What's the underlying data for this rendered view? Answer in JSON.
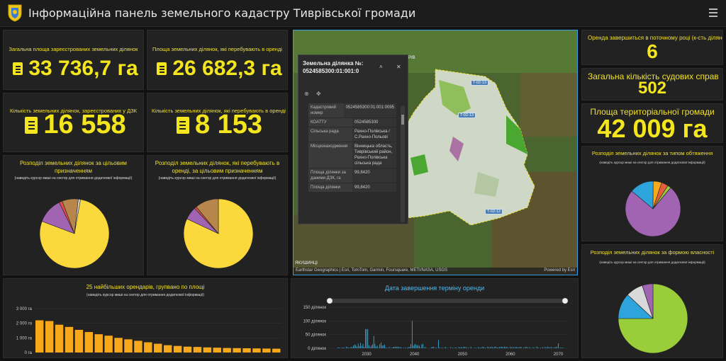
{
  "header": {
    "title": "Інформаційна панель земельного кадастру Тиврівської громади",
    "logo": "coat-of-arms",
    "menu_icon": "hamburger-menu"
  },
  "indicators": [
    {
      "title": "Загальна площа зареєстрованих земельних ділянок",
      "value": "33 736,7 га"
    },
    {
      "title": "Площа земельних ділянок, які перебувають в оренді",
      "value": "26 682,3 га"
    },
    {
      "title": "Кількість земельних ділянок, зареєстрованих у ДЗК",
      "value": "16 558"
    },
    {
      "title": "Кількість земельних ділянок, які перебувають в оренді",
      "value": "8 153"
    }
  ],
  "pie_purpose": {
    "title": "Розподіл земельних ділянок за цільовим призначенням",
    "hint": "(наведіть курсор миші на сектор для отримання додаткової інформації)"
  },
  "pie_lease": {
    "title": "Розподіл земельних ділянок, які перебувають в оренді, за цільовим призначенням",
    "hint": "(наведіть курсор миші на сектор для отримання додаткової інформації)"
  },
  "right_stats": [
    {
      "title": "Оренда завершиться в поточному році (к-сть ділянок)",
      "value": "6"
    },
    {
      "title": "Загальна кількість судових справ",
      "value": "502"
    },
    {
      "title": "Площа територіальної громади",
      "value": "42 009 га"
    }
  ],
  "pie_encumbrance": {
    "title": "Розподіл земельних ділянок за типом обтяження",
    "hint": "(наведіть курсор миші на сектор для отримання додаткової інформації)"
  },
  "pie_ownership": {
    "title": "Розподіл земельних ділянок за формою власності",
    "hint": "(наведіть курсор миші на сектор для отримання додаткової інформації)"
  },
  "map": {
    "attribution": "Earthstar Geographics | Esri, TomTom, Garmin, Foursquare, METI/NASA, USGS",
    "powered": "Powered by Esri",
    "road_labels": [
      "T-02-13",
      "T-02-13",
      "T-02-12"
    ],
    "place_labels": [
      "ТИВРІВ",
      "ЯКУШИНЦІ"
    ],
    "popup": {
      "title": "Земельна ділянка №: 0524585300:01:001:0",
      "collapse_icon": "chevron-up",
      "close_icon": "close",
      "tools": [
        "zoom-to-icon",
        "pan-icon"
      ],
      "rows": [
        {
          "key": "Кадастровий номер",
          "value": "0524585300:01:001:0095"
        },
        {
          "key": "КОАТТУ",
          "value": "0524585300"
        },
        {
          "key": "Сільська рада",
          "value": "Рахно-Полівська / С.Рахно-Польові"
        },
        {
          "key": "Місцезнаходження",
          "value": "Вінницька область, Тиврівський район, Рахно-Полівська сільська рада"
        },
        {
          "key": "Площа ділянки за даними ДЗК, га",
          "value": "99,8420"
        },
        {
          "key": "Площа ділянки",
          "value": "99,8420"
        }
      ]
    }
  },
  "bar_chart": {
    "title": "25 найбільших орендарів, групвано по площі",
    "hint": "(наведіть курсор миші на сектор для отримання додаткової інформації)"
  },
  "timeline": {
    "title": "Дата завершення терміну оренди"
  },
  "colors": {
    "accent": "#f3e51e",
    "bar": "#f7a81b",
    "timeline": "#3bb8e6"
  },
  "chart_data": [
    {
      "type": "pie",
      "name": "purpose",
      "values": [
        78,
        12,
        1.5,
        7.5,
        1
      ],
      "colors": [
        "#fbd93c",
        "#a064b3",
        "#e04b4b",
        "#b8864b",
        "#d9d9d9"
      ]
    },
    {
      "type": "pie",
      "name": "lease",
      "values": [
        82,
        6,
        1,
        11
      ],
      "colors": [
        "#fbd93c",
        "#a064b3",
        "#e04b4b",
        "#b8864b"
      ]
    },
    {
      "type": "pie",
      "name": "encumbrance",
      "values": [
        75,
        14,
        5,
        4,
        2
      ],
      "colors": [
        "#a064b3",
        "#2ea4dc",
        "#f7a81b",
        "#e45f3b",
        "#9acd3a"
      ]
    },
    {
      "type": "pie",
      "name": "ownership",
      "values": [
        75,
        12,
        8,
        5
      ],
      "colors": [
        "#9acd3a",
        "#2ea4dc",
        "#d9d9d9",
        "#a064b3"
      ]
    },
    {
      "type": "bar",
      "ylabels": [
        "3 000 га",
        "2 000 га",
        "1 000 га",
        "0 га"
      ],
      "ylim": [
        0,
        3000
      ],
      "values": [
        2200,
        2150,
        1900,
        1750,
        1550,
        1400,
        1250,
        1150,
        1000,
        900,
        800,
        700,
        600,
        500,
        450,
        400,
        380,
        350,
        330,
        310,
        300,
        290,
        280,
        270,
        260
      ]
    },
    {
      "type": "bar",
      "ylabels": [
        "150 ділянок",
        "100 ділянок",
        "50 ділянок",
        "0 ділянок"
      ],
      "ylim": [
        0,
        150
      ],
      "xlabels": [
        "2030",
        "2040",
        "2050",
        "2060",
        "2070"
      ],
      "xlim": [
        2022,
        2072
      ]
    }
  ]
}
